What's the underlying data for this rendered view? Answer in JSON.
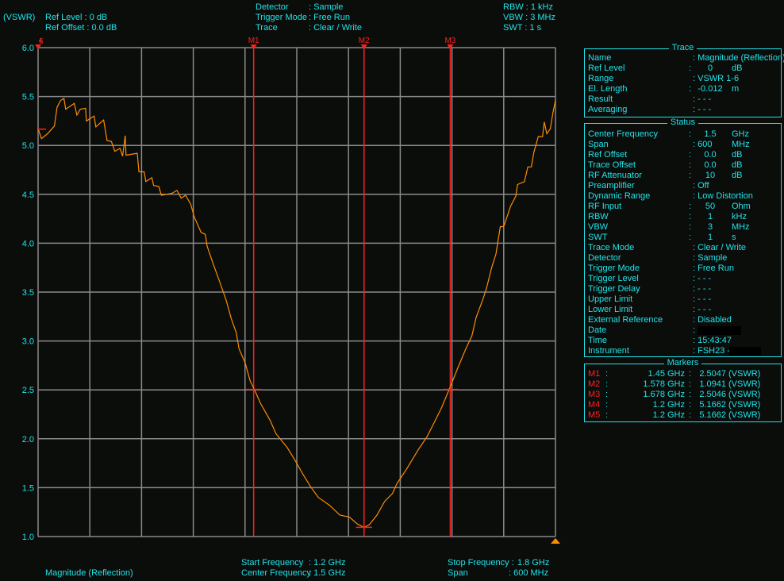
{
  "header": {
    "unit": "(VSWR)",
    "ref_level": "Ref Level : 0   dB",
    "ref_offset": "Ref Offset : 0.0 dB",
    "detector_label": "Detector",
    "detector_value": ": Sample",
    "trigger_label": "Trigger Mode",
    "trigger_value": ": Free Run",
    "trace_label": "Trace",
    "trace_value": ": Clear / Write",
    "rbw": "RBW : 1 kHz",
    "vbw": "VBW : 3 MHz",
    "swt": "SWT : 1 s"
  },
  "footer": {
    "trace_name": "Magnitude (Reflection)",
    "start_label": "Start Frequency",
    "start_value": ": 1.2 GHz",
    "center_label": "Center Frequency",
    "center_value": ": 1.5 GHz",
    "stop_label": "Stop Frequency :",
    "stop_value": "1.8 GHz",
    "span_label": "Span",
    "span_value": ": 600   MHz"
  },
  "trace_panel": {
    "title": "Trace",
    "rows": [
      {
        "label": "Name",
        "value": ": Magnitude (Reflection)"
      },
      {
        "label": "Ref Level",
        "num": "0",
        "unit": "dB"
      },
      {
        "label": "Range",
        "value": ": VSWR 1-6"
      },
      {
        "label": "El. Length",
        "num": "-0.012",
        "unit": "m"
      },
      {
        "label": "Result",
        "value": ": - - -"
      },
      {
        "label": "Averaging",
        "value": ": - - -"
      }
    ]
  },
  "status_panel": {
    "title": "Status",
    "rows": [
      {
        "label": "Center Frequency",
        "num": "1.5",
        "unit": "GHz"
      },
      {
        "label": "Span",
        "value": ": 600",
        "unit": "MHz"
      },
      {
        "label": "Ref Offset",
        "num": "0.0",
        "unit": "dB"
      },
      {
        "label": "Trace Offset",
        "num": "0.0",
        "unit": "dB"
      },
      {
        "label": "RF Attenuator",
        "num": "10",
        "unit": "dB"
      },
      {
        "label": "Preamplifier",
        "value": ": Off"
      },
      {
        "label": "Dynamic Range",
        "value": ": Low Distortion"
      },
      {
        "label": "RF Input",
        "num": "50",
        "unit": "Ohm"
      },
      {
        "label": "RBW",
        "num": "1",
        "unit": "kHz"
      },
      {
        "label": "VBW",
        "num": "3",
        "unit": "MHz"
      },
      {
        "label": "SWT",
        "num": "1",
        "unit": "s"
      },
      {
        "label": "Trace Mode",
        "value": ": Clear / Write"
      },
      {
        "label": "Detector",
        "value": ": Sample"
      },
      {
        "label": "Trigger Mode",
        "value": ": Free Run"
      },
      {
        "label": "Trigger Level",
        "value": ": - - -"
      },
      {
        "label": "Trigger Delay",
        "value": ": - - -"
      },
      {
        "label": "Upper Limit",
        "value": ": - - -"
      },
      {
        "label": "Lower Limit",
        "value": ": - - -"
      },
      {
        "label": "External Reference",
        "value": ": Disabled"
      },
      {
        "label": "Date",
        "value": ": '",
        "redact": 1
      },
      {
        "label": "Time",
        "value": ": 15:43:47"
      },
      {
        "label": "Instrument",
        "value": ": FSH23 - ",
        "redact": 2
      }
    ]
  },
  "markers_panel": {
    "title": "Markers",
    "rows": [
      {
        "name": "M1",
        "freq": "1.45 GHz",
        "value": "2.5047",
        "unit": "(VSWR)"
      },
      {
        "name": "M2",
        "freq": "1.578 GHz",
        "value": "1.0941",
        "unit": "(VSWR)"
      },
      {
        "name": "M3",
        "freq": "1.678 GHz",
        "value": "2.5046",
        "unit": "(VSWR)"
      },
      {
        "name": "M4",
        "freq": "1.2 GHz",
        "value": "5.1662",
        "unit": "(VSWR)"
      },
      {
        "name": "M5",
        "freq": "1.2 GHz",
        "value": "5.1662",
        "unit": "(VSWR)"
      }
    ]
  },
  "colors": {
    "text": "#21e3e8",
    "trace": "#ff8c00",
    "marker": "#ff2020",
    "grid": "#8a8a8a",
    "background": "#0b0d0b"
  },
  "chart_data": {
    "type": "line",
    "xlabel": "",
    "ylabel": "(VSWR)",
    "xlim": [
      1.2,
      1.8
    ],
    "ylim": [
      1.0,
      6.0
    ],
    "x_unit": "GHz",
    "grid": true,
    "yticks": [
      "6.0",
      "5.5",
      "5.0",
      "4.5",
      "4.0",
      "3.5",
      "3.0",
      "2.5",
      "2.0",
      "1.5",
      "1.0"
    ],
    "series": [
      {
        "x": [
          1.2,
          1.204,
          1.211,
          1.216,
          1.219,
          1.222,
          1.226,
          1.23,
          1.232,
          1.242,
          1.245,
          1.249,
          1.255,
          1.256,
          1.265,
          1.267,
          1.276,
          1.28,
          1.285,
          1.289,
          1.295,
          1.298,
          1.301,
          1.302,
          1.315,
          1.317,
          1.323,
          1.325,
          1.332,
          1.334,
          1.34,
          1.343,
          1.355,
          1.361,
          1.366,
          1.371,
          1.377,
          1.381,
          1.389,
          1.394,
          1.396,
          1.403,
          1.41,
          1.418,
          1.424,
          1.43,
          1.433,
          1.44,
          1.446,
          1.451,
          1.458,
          1.469,
          1.476,
          1.489,
          1.498,
          1.507,
          1.516,
          1.525,
          1.538,
          1.55,
          1.561,
          1.57,
          1.578,
          1.584,
          1.593,
          1.602,
          1.611,
          1.616,
          1.628,
          1.641,
          1.651,
          1.659,
          1.668,
          1.677,
          1.687,
          1.696,
          1.703,
          1.708,
          1.716,
          1.72,
          1.726,
          1.731,
          1.736,
          1.74,
          1.748,
          1.754,
          1.756,
          1.764,
          1.768,
          1.772,
          1.775,
          1.78,
          1.785,
          1.787,
          1.79,
          1.794,
          1.797,
          1.8
        ],
        "y": [
          5.17,
          5.07,
          5.12,
          5.17,
          5.2,
          5.39,
          5.46,
          5.48,
          5.37,
          5.43,
          5.31,
          5.37,
          5.38,
          5.25,
          5.3,
          5.19,
          5.26,
          5.05,
          5.04,
          4.94,
          4.97,
          4.89,
          5.1,
          4.9,
          4.92,
          4.73,
          4.73,
          4.63,
          4.67,
          4.59,
          4.58,
          4.49,
          4.51,
          4.54,
          4.46,
          4.49,
          4.4,
          4.27,
          4.11,
          4.09,
          3.97,
          3.79,
          3.62,
          3.42,
          3.23,
          3.08,
          2.92,
          2.78,
          2.59,
          2.5,
          2.36,
          2.19,
          2.05,
          1.91,
          1.78,
          1.64,
          1.51,
          1.4,
          1.32,
          1.22,
          1.2,
          1.13,
          1.094,
          1.12,
          1.22,
          1.36,
          1.44,
          1.54,
          1.7,
          1.89,
          2.02,
          2.16,
          2.32,
          2.51,
          2.73,
          2.92,
          3.05,
          3.24,
          3.43,
          3.54,
          3.75,
          3.89,
          4.17,
          4.17,
          4.38,
          4.48,
          4.6,
          4.63,
          4.78,
          4.78,
          4.93,
          5.09,
          5.09,
          5.24,
          5.12,
          5.17,
          5.33,
          5.46
        ]
      }
    ],
    "markers": [
      {
        "name": "M1",
        "x": 1.45,
        "y": 2.5047,
        "line": true
      },
      {
        "name": "M2",
        "x": 1.578,
        "y": 1.0941,
        "line": true
      },
      {
        "name": "M3",
        "x": 1.678,
        "y": 2.5046,
        "line": true
      },
      {
        "name": "M4",
        "x": 1.2,
        "y": 5.1662,
        "line": false
      },
      {
        "name": "M5",
        "x": 1.2,
        "y": 5.1662,
        "line": false
      }
    ]
  }
}
